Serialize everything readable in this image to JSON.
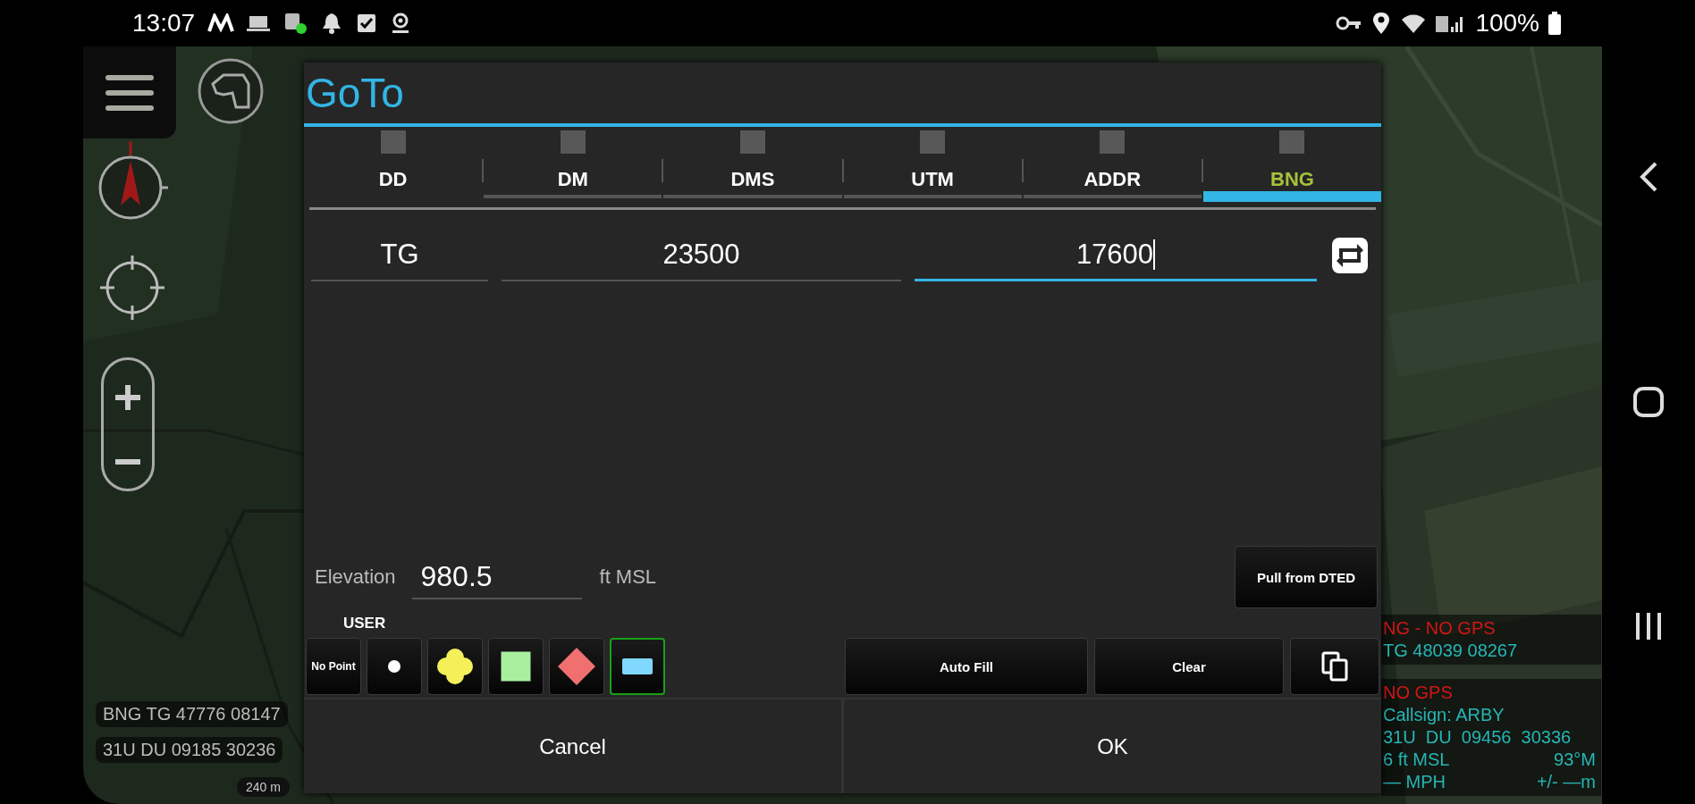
{
  "status_bar": {
    "time": "13:07",
    "battery": "100%"
  },
  "map": {
    "position_readout": [
      "BNG TG 47776 08147",
      "31U DU 09185 30236"
    ],
    "scale": "240 m",
    "self_info": {
      "bng_status": "NG - NO GPS",
      "bng_coord": "TG 48039 08267",
      "gps_status": "NO GPS",
      "callsign": "Callsign: ARBY",
      "mgrs": "31U  DU  09456  30336",
      "altitude": "6 ft MSL",
      "heading": "93°M",
      "speed": "— MPH",
      "accuracy": "+/- —m"
    }
  },
  "dialog": {
    "title": "GoTo",
    "tabs": [
      {
        "label": "DD",
        "selected": false
      },
      {
        "label": "DM",
        "selected": false
      },
      {
        "label": "DMS",
        "selected": false
      },
      {
        "label": "UTM",
        "selected": false
      },
      {
        "label": "ADDR",
        "selected": false
      },
      {
        "label": "BNG",
        "selected": true
      }
    ],
    "fields": [
      {
        "value": "TG",
        "focused": false
      },
      {
        "value": "23500",
        "focused": false
      },
      {
        "value": "17600",
        "focused": true
      }
    ],
    "elevation": {
      "label": "Elevation",
      "value": "980.5",
      "unit": "ft MSL"
    },
    "pull_button": "Pull from DTED",
    "marker_group": "USER",
    "markers": [
      {
        "kind": "text",
        "label": "No Point",
        "selected": false
      },
      {
        "kind": "circle",
        "color": "#ffffff",
        "selected": false
      },
      {
        "kind": "quatrefoil",
        "color": "#f5f05a",
        "selected": false
      },
      {
        "kind": "square",
        "color": "#a8f0a0",
        "selected": false
      },
      {
        "kind": "diamond",
        "color": "#f07070",
        "selected": false
      },
      {
        "kind": "rectangle",
        "color": "#80d8ff",
        "selected": true
      }
    ],
    "actions": [
      "Auto Fill",
      "Clear"
    ],
    "buttons": [
      "Cancel",
      "OK"
    ]
  }
}
